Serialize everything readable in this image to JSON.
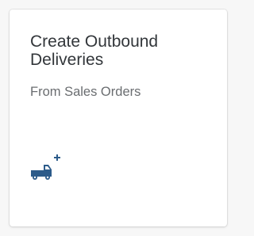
{
  "tile": {
    "title": "Create Outbound\nDeliveries",
    "subtitle": "From Sales Orders",
    "icon": "truck-add-icon",
    "icon_color": "#2c5b8a"
  }
}
